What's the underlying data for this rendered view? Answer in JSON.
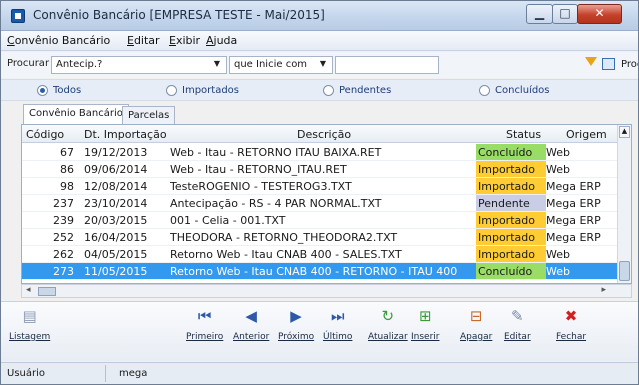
{
  "window": {
    "title": "Convênio Bancário [EMPRESA TESTE - Mai/2015]",
    "min_glyph": "▁",
    "max_glyph": "□",
    "close_glyph": "✕"
  },
  "menu": [
    "Convênio Bancário",
    "Editar",
    "Exibir",
    "Ajuda"
  ],
  "search": {
    "label": "Procurar",
    "field_value": "Antecip.?",
    "mode_value": "que Inicie com",
    "text_value": "",
    "button_label": "Procurar"
  },
  "filters": {
    "options": [
      "Todos",
      "Importados",
      "Pendentes",
      "Concluídos"
    ],
    "selected": "Todos"
  },
  "tabs": [
    "Convênio Bancário",
    "Parcelas"
  ],
  "table": {
    "columns": [
      "Código",
      "Dt. Importação",
      "Descrição",
      "Status",
      "Origem"
    ],
    "rows": [
      {
        "codigo": "67",
        "data": "19/12/2013",
        "descricao": "Web - Itau - RETORNO ITAU BAIXA.RET",
        "status": "Concluído",
        "origem": "Web"
      },
      {
        "codigo": "86",
        "data": "09/06/2014",
        "descricao": "Web - Itau - RETORNO_ITAU.RET",
        "status": "Importado",
        "origem": "Web"
      },
      {
        "codigo": "98",
        "data": "12/08/2014",
        "descricao": "TesteROGENIO - TESTEROG3.TXT",
        "status": "Importado",
        "origem": "Mega ERP"
      },
      {
        "codigo": "237",
        "data": "23/10/2014",
        "descricao": "Antecipação - RS - 4 PAR NORMAL.TXT",
        "status": "Pendente",
        "origem": "Mega ERP"
      },
      {
        "codigo": "239",
        "data": "20/03/2015",
        "descricao": "001 - Celia - 001.TXT",
        "status": "Importado",
        "origem": "Mega ERP"
      },
      {
        "codigo": "252",
        "data": "16/04/2015",
        "descricao": "THEODORA - RETORNO_THEODORA2.TXT",
        "status": "Importado",
        "origem": "Mega ERP"
      },
      {
        "codigo": "262",
        "data": "04/05/2015",
        "descricao": "Retorno Web - Itau CNAB 400 - SALES.TXT",
        "status": "Importado",
        "origem": "Web"
      },
      {
        "codigo": "273",
        "data": "11/05/2015",
        "descricao": "Retorno Web - Itau CNAB 400 - RETORNO - ITAU 400",
        "status": "Concluído",
        "origem": "Web"
      }
    ],
    "selected_row": 7
  },
  "status_colors": {
    "Concluído": "#99dd66",
    "Importado": "#ffcc33",
    "Pendente": "#c9cde6"
  },
  "toolbar": {
    "buttons": [
      {
        "label": "Listagem",
        "icon": "report-icon",
        "glyph": "▤",
        "color": "#8a9bb5"
      },
      {
        "label": "Primeiro",
        "icon": "first-icon",
        "glyph": "⏮",
        "color": "#2e58a8"
      },
      {
        "label": "Anterior",
        "icon": "prev-icon",
        "glyph": "◀",
        "color": "#2e58a8"
      },
      {
        "label": "Próximo",
        "icon": "next-icon",
        "glyph": "▶",
        "color": "#2e58a8"
      },
      {
        "label": "Último",
        "icon": "last-icon",
        "glyph": "⏭",
        "color": "#2e58a8"
      },
      {
        "label": "Atualizar",
        "icon": "refresh-icon",
        "glyph": "↻",
        "color": "#3a9a3a"
      },
      {
        "label": "Inserir",
        "icon": "insert-icon",
        "glyph": "⊞",
        "color": "#3a9a3a"
      },
      {
        "label": "Apagar",
        "icon": "delete-icon",
        "glyph": "⊟",
        "color": "#c76b2b"
      },
      {
        "label": "Editar",
        "icon": "edit-icon",
        "glyph": "✎",
        "color": "#7a88a6"
      },
      {
        "label": "Fechar",
        "icon": "close-icon",
        "glyph": "✖",
        "color": "#d02020"
      }
    ]
  },
  "statusbar": {
    "label": "Usuário",
    "value": "mega"
  }
}
